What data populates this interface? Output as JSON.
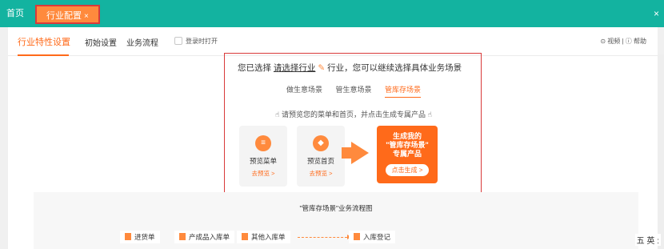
{
  "topbar": {
    "home": "首页",
    "active_tab": "行业配置",
    "active_tab_close": "×",
    "close": "×"
  },
  "subnav": {
    "tabs": [
      "行业特性设置",
      "初始设置",
      "业务流程"
    ],
    "checkbox_label": "登录时打开",
    "help": "⊙ 视频 | ⓘ 帮助"
  },
  "panel": {
    "hint_prefix": "您已选择",
    "hint_link": "请选择行业",
    "hint_pen": "✎",
    "hint_suffix": "行业，您可以继续选择具体业务场景",
    "scenes": [
      "做生意场景",
      "管生意场景",
      "管库存场景"
    ],
    "preview_hint": "请预览您的菜单和首页，并点击生成专属产品",
    "boxes": [
      {
        "icon": "≡",
        "label": "预览菜单",
        "go": "去预览 >"
      },
      {
        "icon": "◆",
        "label": "预览首页",
        "go": "去预览 >"
      }
    ],
    "gen_text": "生成我的\n\"管库存场景\"\n专属产品",
    "gen_line1": "生成我的",
    "gen_line2": "\"管库存场景\"",
    "gen_line3": "专属产品",
    "gen_button": "点击生成 >"
  },
  "flow": {
    "title": "\"管库存场景\"业务流程图",
    "nodes": [
      "进货单",
      "产成品入库单",
      "其他入库单",
      "入库登记"
    ]
  },
  "ime": "五 英 :"
}
